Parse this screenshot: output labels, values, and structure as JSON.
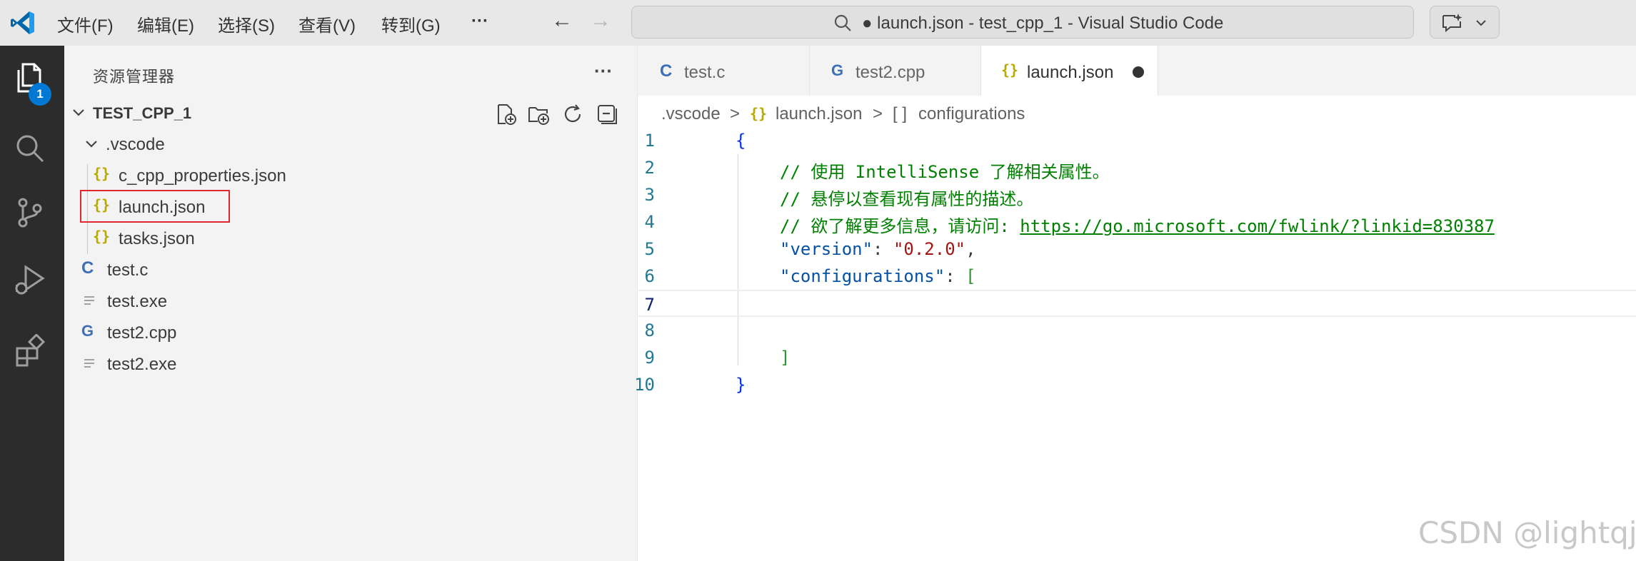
{
  "window": {
    "title": "● launch.json - test_cpp_1 - Visual Studio Code",
    "menu": [
      "文件(F)",
      "编辑(E)",
      "选择(S)",
      "查看(V)",
      "转到(G)"
    ],
    "more": "···",
    "back": "←",
    "forward": "→"
  },
  "activity": {
    "explorer_badge": "1"
  },
  "sidebar": {
    "title": "资源管理器",
    "more": "···",
    "project": "TEST_CPP_1",
    "folder": ".vscode",
    "folder_children": [
      "c_cpp_properties.json",
      "launch.json",
      "tasks.json"
    ],
    "files": [
      "test.c",
      "test.exe",
      "test2.cpp",
      "test2.exe"
    ],
    "json_icon": "{}",
    "c_icon": "C",
    "cpp_icon": "G"
  },
  "tabs": [
    {
      "label": "test.c",
      "icon": "C"
    },
    {
      "label": "test2.cpp",
      "icon": "G"
    },
    {
      "label": "launch.json",
      "icon": "{}"
    }
  ],
  "breadcrumb": {
    "folder": ".vscode",
    "file": "launch.json",
    "symbol": "configurations",
    "symbol_icon": "[ ]",
    "sep": ">"
  },
  "code": {
    "line_numbers": [
      "1",
      "2",
      "3",
      "4",
      "5",
      "6",
      "7",
      "8",
      "9",
      "10"
    ],
    "l1": "{",
    "l2": "// 使用 IntelliSense 了解相关属性。",
    "l3": "// 悬停以查看现有属性的描述。",
    "l4_comment": "// 欲了解更多信息，请访问: ",
    "l4_link": "https://go.microsoft.com/fwlink/?linkid=830387",
    "l5_key": "\"version\"",
    "l5_colon": ": ",
    "l5_val": "\"0.2.0\"",
    "l5_comma": ",",
    "l6_key": "\"configurations\"",
    "l6_colon": ": ",
    "l6_open": "[",
    "l9": "]",
    "l10": "}"
  },
  "watermark": "CSDN @lightqjx",
  "colors": {
    "accent": "#0078d4",
    "highlight_box": "#e0282e",
    "json_icon": "#b7a900",
    "c_icon": "#3d6fb6"
  }
}
